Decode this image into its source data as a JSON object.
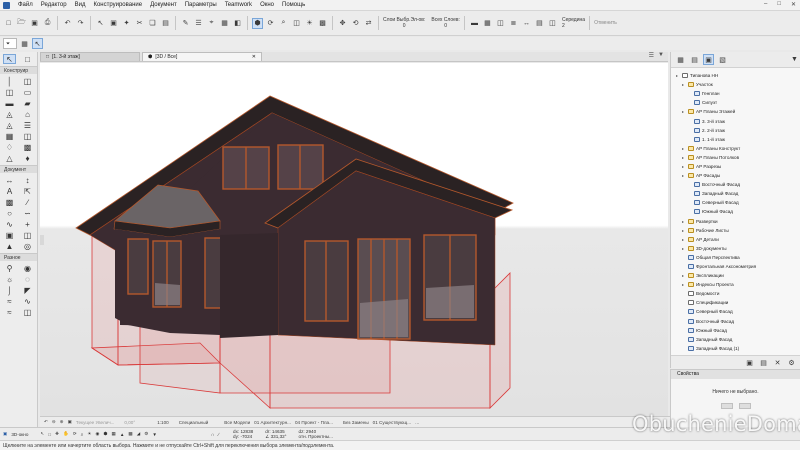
{
  "menu": [
    "Файл",
    "Редактор",
    "Вид",
    "Конструирование",
    "Документ",
    "Параметры",
    "Teamwork",
    "Окно",
    "Помощь"
  ],
  "toolbar": {
    "layers_label": "Слои Выбр.Эл-ов:",
    "all_layers_label": "Всех Слоев:",
    "layers_value_1": "0",
    "layers_value_2": "0",
    "center_label": "Середина",
    "center_value": "2",
    "cancel_label": "Отменить"
  },
  "toolbox": {
    "sections": [
      "Конструир",
      "Документ",
      "Разное"
    ]
  },
  "tabs": [
    {
      "label": "[1. 3-й этаж]"
    },
    {
      "label": "[3D / Все]"
    }
  ],
  "navigator": {
    "items": [
      {
        "label": "Типанова НН",
        "depth": 0,
        "icon": "sheet"
      },
      {
        "label": "Участок",
        "depth": 1,
        "icon": "folder"
      },
      {
        "label": "Генплан",
        "depth": 2,
        "icon": "plan"
      },
      {
        "label": "Силуэт",
        "depth": 2,
        "icon": "plan"
      },
      {
        "label": "АР Планы Этажей",
        "depth": 1,
        "icon": "folder"
      },
      {
        "label": "3. 3-й этаж",
        "depth": 2,
        "icon": "plan"
      },
      {
        "label": "2. 2-й этаж",
        "depth": 2,
        "icon": "plan"
      },
      {
        "label": "1. 1-й этаж",
        "depth": 2,
        "icon": "plan"
      },
      {
        "label": "АР Планы Конструкт",
        "depth": 1,
        "icon": "folder"
      },
      {
        "label": "АР Планы Потолков",
        "depth": 1,
        "icon": "folder"
      },
      {
        "label": "АР Разрезы",
        "depth": 1,
        "icon": "folder"
      },
      {
        "label": "АР Фасады",
        "depth": 1,
        "icon": "folder"
      },
      {
        "label": "Восточный Фасад",
        "depth": 2,
        "icon": "plan"
      },
      {
        "label": "Западный Фасад",
        "depth": 2,
        "icon": "plan"
      },
      {
        "label": "Северный Фасад",
        "depth": 2,
        "icon": "plan"
      },
      {
        "label": "Южный Фасад",
        "depth": 2,
        "icon": "plan"
      },
      {
        "label": "Развертки",
        "depth": 1,
        "icon": "folder"
      },
      {
        "label": "Рабочие Листы",
        "depth": 1,
        "icon": "folder"
      },
      {
        "label": "АР Детали",
        "depth": 1,
        "icon": "folder"
      },
      {
        "label": "3D-документы",
        "depth": 1,
        "icon": "folder"
      },
      {
        "label": "Общая Перспектива",
        "depth": 1,
        "icon": "plan"
      },
      {
        "label": "Фронтальная Аксонометрия",
        "depth": 1,
        "icon": "plan"
      },
      {
        "label": "Экспликации",
        "depth": 1,
        "icon": "folder"
      },
      {
        "label": "Индексы Проекта",
        "depth": 1,
        "icon": "folder"
      },
      {
        "label": "Ведомости",
        "depth": 1,
        "icon": "sheet"
      },
      {
        "label": "Спецификации",
        "depth": 1,
        "icon": "sheet"
      },
      {
        "label": "Северный Фасад",
        "depth": 1,
        "icon": "plan"
      },
      {
        "label": "Восточный Фасад",
        "depth": 1,
        "icon": "plan"
      },
      {
        "label": "Южный Фасад",
        "depth": 1,
        "icon": "plan"
      },
      {
        "label": "Западный Фасад",
        "depth": 1,
        "icon": "plan"
      },
      {
        "label": "Западный Фасад (1)",
        "depth": 1,
        "icon": "plan"
      },
      {
        "label": "Южный Фасад",
        "depth": 1,
        "icon": "plan"
      }
    ]
  },
  "properties": {
    "title": "Свойства",
    "empty_text": "Ничего не выбрано."
  },
  "quickbar": {
    "items": [
      "Текущее Увелич...",
      "0,00°",
      "1:100",
      "Специальный",
      "Все Модели",
      "01 Архитектурн...",
      "04 Проект - Пла...",
      "Без Замены",
      "01 Существующ...",
      "…"
    ]
  },
  "infobar": {
    "view_label": "3D-окно",
    "dx_label": "dx: 12838",
    "dy_label": "dy: -7024",
    "dr_label": "dr: 14635",
    "angle_label": "∠ 331,32°",
    "dz_label": "dz: 2940",
    "ref_label": "отн. Проектны..."
  },
  "statusbar": {
    "text": "Щелкните на элементе или начертите область выбора. Нажмите и не отпускайте Ctrl+Shift для переключения выбора элемента/подэлемента."
  },
  "watermark": "ObuchenieDoma.ru",
  "colors": {
    "wall": "#3b2b31",
    "roof": "#2a2223",
    "frame": "#b4582c",
    "zone": "#d93a3a"
  }
}
